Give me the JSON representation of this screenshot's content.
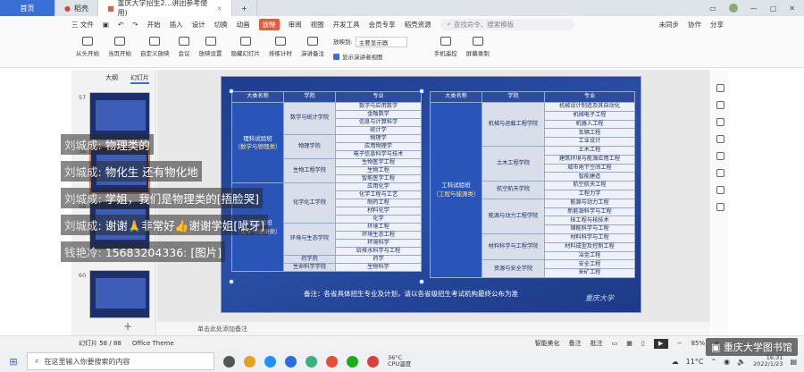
{
  "titlebar": {
    "home_tab": "首页",
    "docer_tab": "稻壳",
    "doc_tab": "重庆大学招生2...讲团参考使用)",
    "new_tab": "+"
  },
  "menu": {
    "file": "三 文件",
    "items": [
      "开始",
      "插入",
      "设计",
      "切换",
      "动画",
      "放映",
      "审阅",
      "视图",
      "开发工具",
      "会员专享",
      "稻壳资源"
    ],
    "active_index": 5,
    "search_placeholder": "查找命令、搜索模板",
    "sync": "未同步",
    "collab": "协作",
    "share": "分享"
  },
  "ribbon": {
    "buttons": [
      "从头开始",
      "当页开始",
      "自定义放映",
      "会议",
      "放映设置",
      "隐藏幻灯片",
      "排练计时",
      "演讲备注"
    ],
    "cast_label": "放映到:",
    "cast_value": "主要显示器",
    "presenter_view": "显示演讲者视图",
    "remote": "手机遥控",
    "record": "屏幕录制"
  },
  "left_panel": {
    "tab_outline": "大纲",
    "tab_slides": "幻灯片",
    "thumbs": [
      {
        "num": "57"
      },
      {
        "num": "58"
      },
      {
        "num": "59"
      },
      {
        "num": "60"
      }
    ],
    "selected": "58",
    "add": "+"
  },
  "slide": {
    "left_table": {
      "headers": [
        "大类名称",
        "学院",
        "专业"
      ],
      "categories": [
        {
          "name": "理科试验班",
          "sub": "（数学与物理类）",
          "rows": 10
        },
        {
          "name": "理科试验班",
          "sub": "（化学与健康类）",
          "rows": 11
        }
      ],
      "colleges": [
        {
          "name": "数学与统计学院",
          "majors": [
            "数学与应用数学",
            "金融数学",
            "信息与计算科学",
            "统计学"
          ]
        },
        {
          "name": "物理学院",
          "majors": [
            "物理学",
            "应用物理学",
            "电子信息科学与技术"
          ]
        },
        {
          "name": "生物工程学院",
          "majors": [
            "生物医学工程",
            "生物工程",
            "智能医学工程"
          ]
        },
        {
          "name": "化学化工学院",
          "majors": [
            "应用化学",
            "化学工程与工艺",
            "制药工程",
            "材料化学",
            "化学"
          ]
        },
        {
          "name": "环境与生态学院",
          "majors": [
            "环境工程",
            "环境生态工程",
            "环境科学",
            "给排水科学与工程"
          ]
        },
        {
          "name": "药学院",
          "majors": [
            "药学"
          ]
        },
        {
          "name": "生命科学学院",
          "majors": [
            "生物科学"
          ]
        }
      ]
    },
    "right_table": {
      "headers": [
        "大类名称",
        "学院",
        "专业"
      ],
      "categories": [
        {
          "name": "工科试验班",
          "sub": "（工程与能源类）",
          "rows": 20
        }
      ],
      "colleges": [
        {
          "name": "机械与运载工程学院",
          "majors": [
            "机械设计制造及其自动化",
            "机械电子工程",
            "机器人工程",
            "车辆工程",
            "工业设计"
          ]
        },
        {
          "name": "土木工程学院",
          "majors": [
            "土木工程",
            "建筑环境与能源应用工程",
            "城市地下空间工程",
            "智能建造"
          ]
        },
        {
          "name": "航空航天学院",
          "majors": [
            "航空航天工程",
            "工程力学"
          ]
        },
        {
          "name": "能源与动力工程学院",
          "majors": [
            "能源与动力工程",
            "新能源科学与工程",
            "核工程与核技术",
            "储能科学与工程"
          ]
        },
        {
          "name": "材料科学与工程学院",
          "majors": [
            "材料科学与工程",
            "材料成型及控制工程",
            "冶金工程"
          ]
        },
        {
          "name": "资源与安全学院",
          "majors": [
            "安全工程",
            "采矿工程"
          ]
        }
      ]
    },
    "note": "备注：各省具体招生专业及计划，请以各省级招生考试机构最终公布为准",
    "logo": "重庆大学"
  },
  "notes_placeholder": "单击此处添加备注",
  "chat": [
    {
      "who": "刘城成:",
      "text": " 物理类的"
    },
    {
      "who": "刘城成:",
      "text": " 物化生 还有物化地"
    },
    {
      "who": "刘城成:",
      "text": " 学姐，我们是物理类的[捂脸哭]"
    },
    {
      "who": "刘城成:",
      "text": " 谢谢🙏非常好👍谢谢学姐[呲牙]"
    },
    {
      "who": "钱艳冷:",
      "text": " 15683204336: [图片]"
    }
  ],
  "status": {
    "slide_counter": "幻灯片 58 / 88",
    "theme": "Office Theme",
    "beautify": "智能美化",
    "notes": "备注",
    "comments": "批注",
    "zoom": "85%"
  },
  "taskbar": {
    "search_placeholder": "在这里输入你要搜索的内容",
    "temp_cpu": "36°C",
    "temp_cpu_label": "CPU温度",
    "weather": "11°C",
    "time": "16:31",
    "date": "2022/1/23"
  },
  "watermark": "重庆大学图书馆"
}
